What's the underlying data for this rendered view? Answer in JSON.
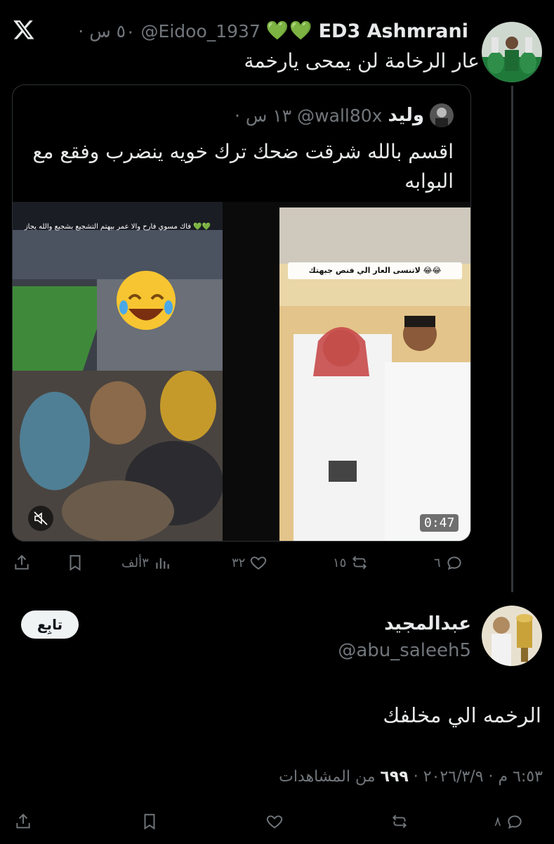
{
  "top_tweet": {
    "display_name": "ED3 Ashmrani",
    "name_emoji": "💚💚",
    "handle": "@Eidoo_1937",
    "time": "· ٥٠ س",
    "text": "عار الرخامة لن يمحى يارخمة"
  },
  "quoted_tweet": {
    "display_name": "وليد",
    "handle": "@wall80x",
    "time": "· ١٣ س",
    "text": "اقسم بالله شرقت ضحك ترك خويه ينضرب وفقع مع البوابه",
    "media": {
      "left_caption": "فاك مسوي فارح والا عمر بيهتم التشجيع بشجيع والله يجاز 💚💚",
      "right_caption": "لاتنسى العار الي فنص جبهتك 😂😂",
      "duration": "0:47"
    },
    "actions": {
      "replies": "٦",
      "reposts": "١٥",
      "likes": "٣٢",
      "views": "٣ألف"
    }
  },
  "reply_tweet": {
    "display_name": "عبدالمجيد",
    "handle": "@abu_saleeh5",
    "follow_label": "تابِع",
    "text": "الرخمه الي مخلفك",
    "meta_date": "٦:٥٣ م · ٢٠٢٦/٣/٩ ·",
    "meta_views": "٦٩٩",
    "meta_views_label": "من المشاهدات",
    "actions": {
      "replies": "٨"
    }
  },
  "colors": {
    "background": "#000000",
    "primary_text": "#e7e9ea",
    "secondary_text": "#71767b",
    "border": "#2f3336",
    "heart_green": "#00ba7c"
  }
}
